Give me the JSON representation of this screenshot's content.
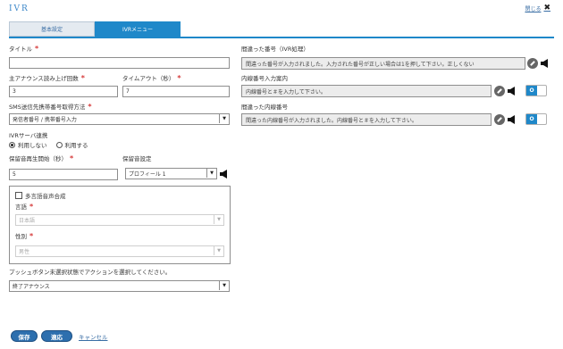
{
  "header": {
    "title": "IVR",
    "close_label": "閉じる"
  },
  "tabs": [
    {
      "label": "基本設定"
    },
    {
      "label": "IVRメニュー"
    }
  ],
  "left": {
    "title_label": "タイトル",
    "title_value": "",
    "main_announce_label": "主アナウンス読み上げ回数",
    "main_announce_value": "3",
    "timeout_label": "タイムアウト（秒）",
    "timeout_value": "7",
    "sms_label": "SMS送信先携帯番号取得方法",
    "sms_value": "発信者番号 / 携帯番号入力",
    "ivr_server_label": "IVRサーバ連携",
    "ivr_server_options": [
      "利用しない",
      "利用する"
    ],
    "hold_start_label": "保留音再生開始（秒）",
    "hold_start_value": "5",
    "hold_setting_label": "保留音設定",
    "hold_setting_value": "プロフィール 1",
    "multilang_label": "多言語音声合成",
    "language_label": "言語",
    "language_value": "日本語",
    "gender_label": "性別",
    "gender_value": "男性",
    "pushbutton_label": "プッシュボタン未選択状態でアクションを選択してください。",
    "pushbutton_value": "終了アナウンス"
  },
  "right": {
    "wrong_number_label": "間違った番号（IVR処理）",
    "wrong_number_value": "間違った番号が入力されました。入力された番号が正しい場合は1を押して下さい。正しくない",
    "extension_label": "内線番号入力案内",
    "extension_value": "内線番号と＃を入力して下さい。",
    "wrong_extension_label": "間違った内線番号",
    "wrong_extension_value": "間違った内線番号が入力されました。内線番号と＃を入力して下さい。",
    "toggle_label": "O"
  },
  "footer": {
    "save_label": "保存",
    "apply_label": "適応",
    "cancel_label": "キャンセル"
  },
  "colors": {
    "accent": "#1f88c9",
    "required": "#d63a3a",
    "button": "#2d6fae"
  }
}
